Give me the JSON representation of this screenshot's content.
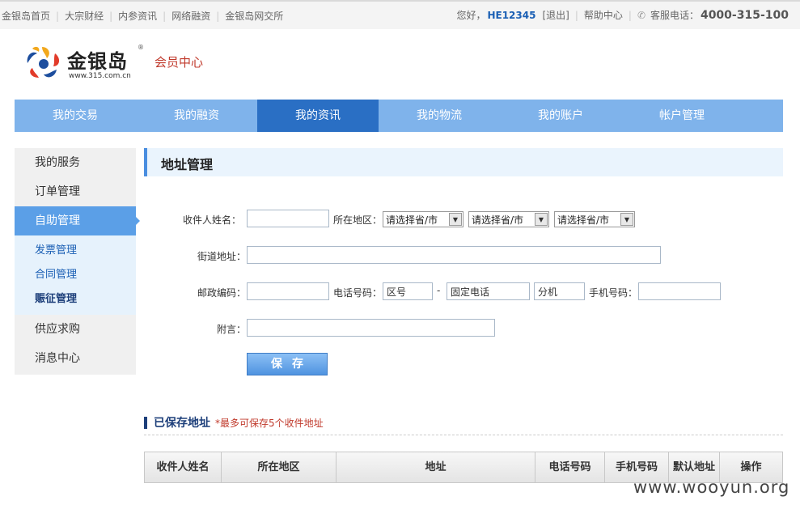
{
  "topbar": {
    "links": [
      "金银岛首页",
      "大宗财经",
      "内参资讯",
      "网络融资",
      "金银岛网交所"
    ],
    "greeting": "您好，",
    "username": "HE12345",
    "logout": "[退出]",
    "help": "帮助中心",
    "service_label": "客服电话：",
    "service_phone": "4000-315-100"
  },
  "logo": {
    "name": "金银岛",
    "reg_mark": "®",
    "url": "www.315.com.cn",
    "subtitle": "会员中心"
  },
  "main_nav": {
    "items": [
      "我的交易",
      "我的融资",
      "我的资讯",
      "我的物流",
      "我的账户",
      "帐户管理"
    ],
    "active_index": 2
  },
  "sidebar": {
    "items_top": [
      "我的服务",
      "订单管理"
    ],
    "active": "自助管理",
    "sub_items": [
      "发票管理",
      "合同管理",
      "赈征管理"
    ],
    "items_bottom": [
      "供应求购",
      "消息中心"
    ]
  },
  "content": {
    "title": "地址管理",
    "form": {
      "recipient_label": "收件人姓名：",
      "recipient_value": "",
      "region_label": "所在地区：",
      "region_selects": [
        "请选择省/市",
        "请选择省/市",
        "请选择省/市"
      ],
      "street_label": "街道地址：",
      "street_value": "",
      "zip_label": "邮政编码：",
      "zip_value": "",
      "phone_label": "电话号码：",
      "area_code_placeholder": "区号",
      "phone_dash": "-",
      "landline_placeholder": "固定电话",
      "ext_placeholder": "分机",
      "mobile_label": "手机号码：",
      "mobile_value": "",
      "remark_label": "附言：",
      "remark_value": "",
      "save_label": "保存"
    },
    "saved": {
      "title": "已保存地址",
      "note": "*最多可保存5个收件地址",
      "columns": [
        "收件人姓名",
        "所在地区",
        "地址",
        "电话号码",
        "手机号码",
        "默认地址",
        "操作"
      ]
    }
  },
  "watermark": "www.wooyun.org",
  "colors": {
    "nav_bg": "#7fb3eb",
    "nav_active": "#2a6fc4",
    "sidebar_active": "#5b9fe7",
    "accent_red": "#c0392b",
    "link_blue": "#1a5fb4"
  }
}
